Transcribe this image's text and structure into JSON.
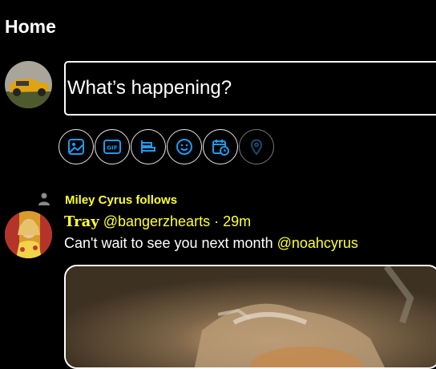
{
  "header": {
    "title": "Home"
  },
  "compose": {
    "placeholder": "What’s happening?",
    "toolbar": [
      {
        "icon": "image-icon"
      },
      {
        "icon": "gif-icon",
        "label": "GIF"
      },
      {
        "icon": "poll-icon"
      },
      {
        "icon": "emoji-icon"
      },
      {
        "icon": "schedule-icon"
      },
      {
        "icon": "location-icon"
      }
    ]
  },
  "timeline": {
    "tweets": [
      {
        "social_context": "Miley Cyrus follows",
        "name": "Tray",
        "handle": "@bangerzhearts",
        "separator": "·",
        "time": "29m",
        "text": "Can't wait to see you next month ",
        "mention": "@noahcyrus"
      }
    ]
  },
  "colors": {
    "accent": "#ffff33",
    "icon_blue": "#1d9bf0",
    "background": "#000000"
  }
}
